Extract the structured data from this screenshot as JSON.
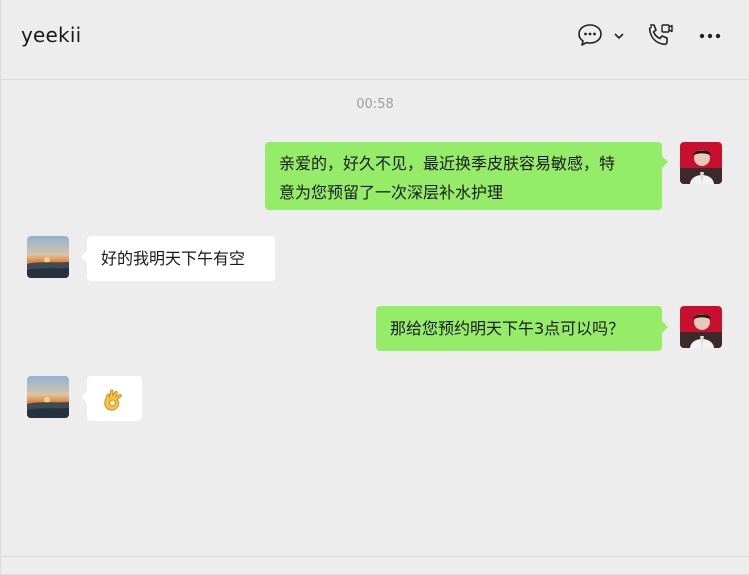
{
  "header": {
    "title": "yeekii",
    "icons": [
      "chat-bubble-icon",
      "chevron-down-icon",
      "video-call-icon",
      "more-icon"
    ]
  },
  "chat": {
    "timestamp": "00:58",
    "messages": [
      {
        "side": "out",
        "text_line1": "亲爱的，好久不见，最近换季皮肤容易敏感，特",
        "text_line2": "意为您预留了一次深层补水护理"
      },
      {
        "side": "in",
        "text": "好的我明天下午有空"
      },
      {
        "side": "out",
        "text": "那给您预约明天下午3点可以吗？"
      },
      {
        "side": "in",
        "emoji": "ok-hand",
        "text": "👌"
      }
    ]
  },
  "colors": {
    "outgoing_bubble": "#95ec69",
    "incoming_bubble": "#ffffff",
    "background": "#ededed"
  }
}
